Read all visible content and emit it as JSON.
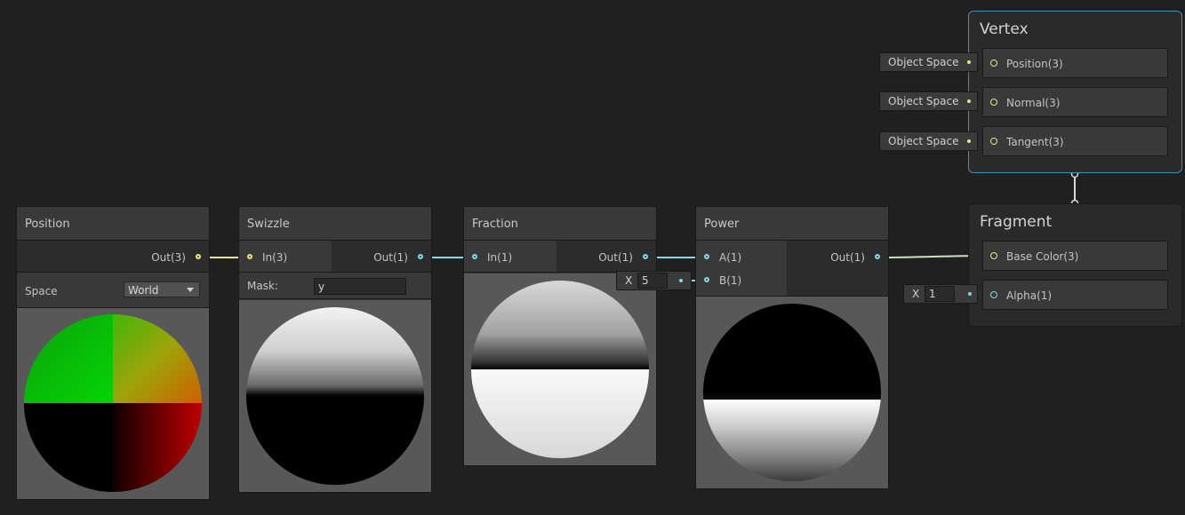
{
  "nodes": {
    "position": {
      "title": "Position",
      "out_label": "Out(3)",
      "space_label": "Space",
      "space_value": "World"
    },
    "swizzle": {
      "title": "Swizzle",
      "in_label": "In(3)",
      "out_label": "Out(1)",
      "mask_label": "Mask:",
      "mask_value": "y"
    },
    "fraction": {
      "title": "Fraction",
      "in_label": "In(1)",
      "out_label": "Out(1)"
    },
    "power": {
      "title": "Power",
      "a_label": "A(1)",
      "b_label": "B(1)",
      "out_label": "Out(1)",
      "b_field_axis": "X",
      "b_field_value": "5"
    }
  },
  "vertex": {
    "title": "Vertex",
    "blocks": [
      {
        "label": "Position(3)",
        "space": "Object Space"
      },
      {
        "label": "Normal(3)",
        "space": "Object Space"
      },
      {
        "label": "Tangent(3)",
        "space": "Object Space"
      }
    ]
  },
  "fragment": {
    "title": "Fragment",
    "blocks": [
      {
        "label": "Base Color(3)"
      },
      {
        "label": "Alpha(1)",
        "field_axis": "X",
        "field_value": "1"
      }
    ]
  },
  "colors": {
    "background": "#202020",
    "node": "#393939",
    "vector3_port": "#e8e885",
    "float_port": "#7fdbe6",
    "selection": "#3d8fb5"
  }
}
